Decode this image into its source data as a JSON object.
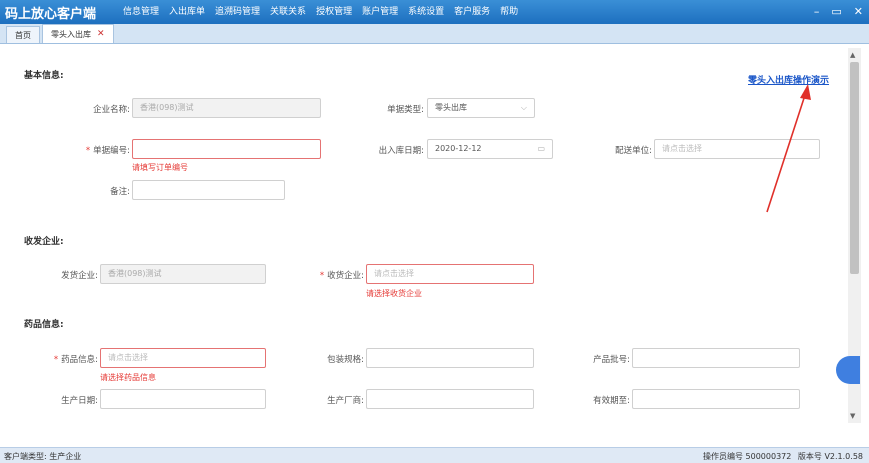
{
  "app": {
    "title": "码上放心客户端",
    "menu": [
      "信息管理",
      "入出库单",
      "追溯码管理",
      "关联关系",
      "授权管理",
      "账户管理",
      "系统设置",
      "客户服务",
      "帮助"
    ],
    "window_controls": [
      "–",
      "▭",
      "✕"
    ]
  },
  "tabs": [
    {
      "label": "首页"
    },
    {
      "label": "零头入出库",
      "close": "✕"
    }
  ],
  "demo_link": "零头入出库操作演示",
  "basic": {
    "title": "基本信息:",
    "company_label": "企业名称:",
    "company_value": "香港(098)测试",
    "doctype_label": "单据类型:",
    "doctype_value": "零头出库",
    "doctype_arrow": "⌵",
    "docno_required": "*",
    "docno_label": "单据编号:",
    "docno_error": "请填写订单编号",
    "date_label": "出入库日期:",
    "date_value": "2020-12-12",
    "date_icon": "▭",
    "delivery_label": "配送单位:",
    "delivery_placeholder": "请点击选择",
    "remark_label": "备注:"
  },
  "shipping": {
    "title": "收发企业:",
    "sender_label": "发货企业:",
    "sender_value": "香港(098)测试",
    "receiver_required": "*",
    "receiver_label": "收货企业:",
    "receiver_placeholder": "请点击选择",
    "receiver_error": "请选择收货企业"
  },
  "drug": {
    "title": "药品信息:",
    "drug_required": "*",
    "drug_label": "药品信息:",
    "drug_placeholder": "请点击选择",
    "drug_error": "请选择药品信息",
    "package_label": "包装规格:",
    "batch_label": "产品批号:",
    "mfg_date_label": "生产日期:",
    "maker_label": "生产厂商:",
    "expiry_label": "有效期至:"
  },
  "status": {
    "client_type": "客户端类型: 生产企业",
    "operator": "操作员编号 500000372",
    "version": "版本号 V2.1.0.58"
  },
  "colors": {
    "title_bar": "#1d6fbf",
    "error": "#e53935",
    "annotation_arrow": "#e0302a",
    "link": "#1a56c8"
  }
}
